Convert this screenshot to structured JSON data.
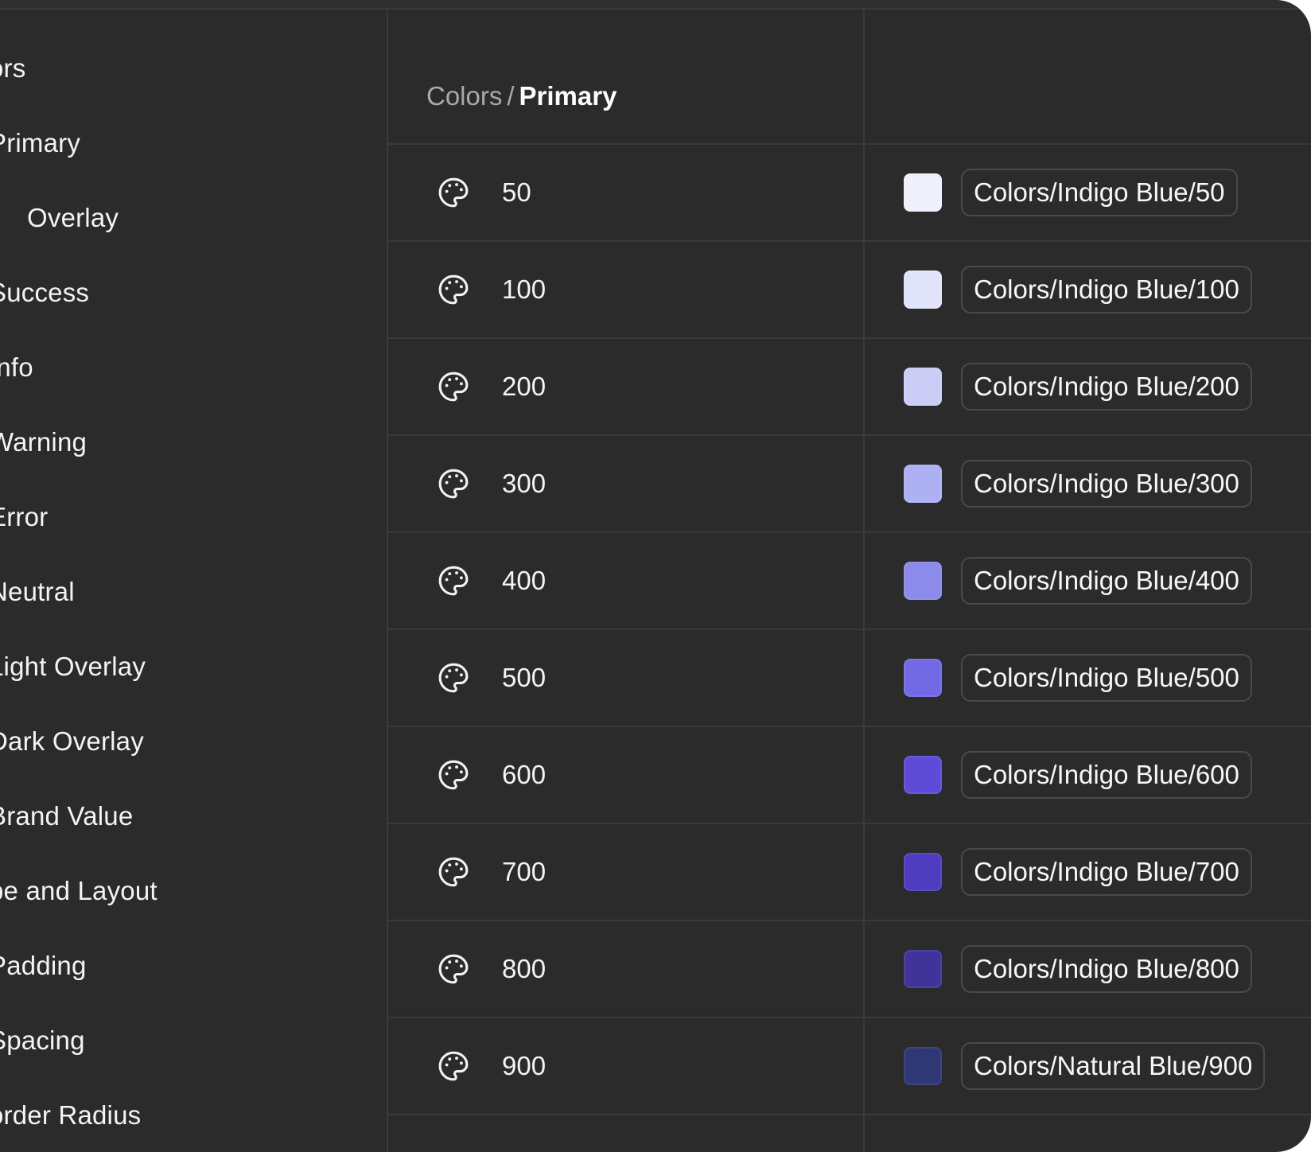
{
  "sidebar": {
    "items": [
      {
        "label": "ors",
        "indent": false
      },
      {
        "label": "Primary",
        "indent": false
      },
      {
        "label": "Overlay",
        "indent": true
      },
      {
        "label": "Success",
        "indent": false
      },
      {
        "label": "Info",
        "indent": false
      },
      {
        "label": "Warning",
        "indent": false
      },
      {
        "label": "Error",
        "indent": false
      },
      {
        "label": "Neutral",
        "indent": false
      },
      {
        "label": "Light Overlay",
        "indent": false
      },
      {
        "label": "Dark Overlay",
        "indent": false
      },
      {
        "label": "Brand Value",
        "indent": false
      },
      {
        "label": "pe and Layout",
        "indent": false
      },
      {
        "label": "Padding",
        "indent": false
      },
      {
        "label": "Spacing",
        "indent": false
      },
      {
        "label": "order Radius",
        "indent": false
      }
    ]
  },
  "breadcrumb": {
    "parent": "Colors",
    "separator": "/",
    "current": "Primary"
  },
  "rows": [
    {
      "value": "50",
      "token": "Colors/Indigo Blue/50",
      "color": "#eef0fc",
      "icon": "palette-icon"
    },
    {
      "value": "100",
      "token": "Colors/Indigo Blue/100",
      "color": "#e1e3fb",
      "icon": "palette-icon"
    },
    {
      "value": "200",
      "token": "Colors/Indigo Blue/200",
      "color": "#cbcdf7",
      "icon": "palette-icon"
    },
    {
      "value": "300",
      "token": "Colors/Indigo Blue/300",
      "color": "#adb1f3",
      "icon": "palette-icon"
    },
    {
      "value": "400",
      "token": "Colors/Indigo Blue/400",
      "color": "#8c8bec",
      "icon": "palette-icon"
    },
    {
      "value": "500",
      "token": "Colors/Indigo Blue/500",
      "color": "#726ae4",
      "icon": "palette-icon"
    },
    {
      "value": "600",
      "token": "Colors/Indigo Blue/600",
      "color": "#5e4cd8",
      "icon": "palette-icon"
    },
    {
      "value": "700",
      "token": "Colors/Indigo Blue/700",
      "color": "#4f3dbf",
      "icon": "palette-icon"
    },
    {
      "value": "800",
      "token": "Colors/Indigo Blue/800",
      "color": "#40349a",
      "icon": "palette-icon"
    },
    {
      "value": "900",
      "token": "Colors/Natural Blue/900",
      "color": "#2f3775",
      "icon": "palette-icon"
    }
  ]
}
